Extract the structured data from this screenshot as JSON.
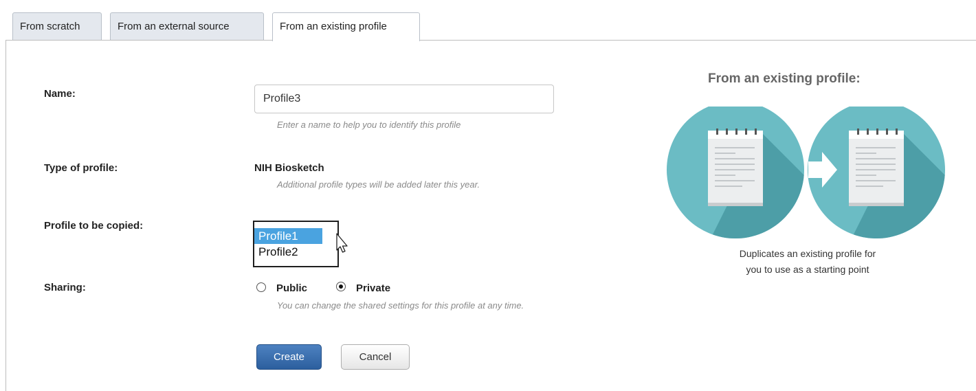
{
  "tabs": [
    {
      "label": "From scratch"
    },
    {
      "label": "From an external source"
    },
    {
      "label": "From an existing profile"
    }
  ],
  "form": {
    "name_label": "Name:",
    "name_value": "Profile3",
    "name_hint": "Enter a name to help you to identify this profile",
    "type_label": "Type of profile:",
    "type_value": "NIH Biosketch",
    "type_hint": "Additional profile types will be added later this year.",
    "copy_label": "Profile to be copied:",
    "copy_options": [
      "Profile1",
      "Profile2"
    ],
    "copy_selected": "Profile1",
    "sharing_label": "Sharing:",
    "sharing_options": [
      "Public",
      "Private"
    ],
    "sharing_selected": "Private",
    "sharing_hint": "You can change the shared settings for this profile at any time.",
    "create_label": "Create",
    "cancel_label": "Cancel"
  },
  "side": {
    "title": "From an existing profile:",
    "description_line1": "Duplicates an existing profile for",
    "description_line2": "you to use as a starting point",
    "illustration": "document-copy-icon"
  },
  "colors": {
    "accent": "#2c5f9e",
    "circle": "#6bbcc4",
    "selection": "#4aa3e0"
  }
}
